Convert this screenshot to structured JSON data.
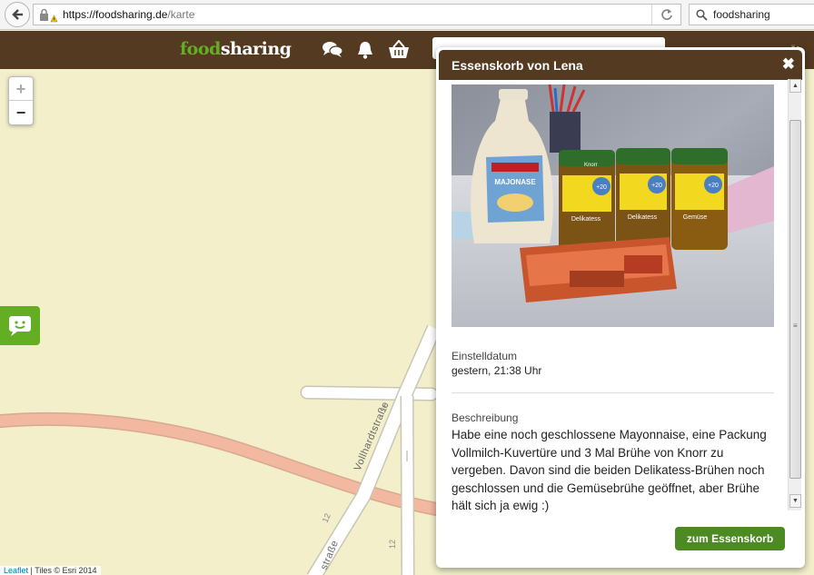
{
  "browser": {
    "url_domain": "https://foodsharing.de",
    "url_path": "/karte",
    "search_value": "foodsharing"
  },
  "header": {
    "logo_part1": "food",
    "logo_part2": "sharing",
    "clipped_text": "ör"
  },
  "map": {
    "zoom_in": "+",
    "zoom_out": "−",
    "street_label": "Vollhardtstraße",
    "street_label_2": "straße",
    "house_numbers": [
      "10",
      "12",
      "12"
    ],
    "attribution_leaflet": "Leaflet",
    "attribution_rest": " | Tiles © Esri 2014"
  },
  "popup": {
    "title": "Essenskorb von Lena",
    "close": "✖",
    "date_label": "Einstelldatum",
    "date_value": "gestern, 21:38 Uhr",
    "desc_label": "Beschreibung",
    "desc_text": "Habe eine noch geschlossene Mayonnaise, eine Packung Vollmilch-Kuvertüre und 3 Mal Brühe von Knorr zu vergeben. Davon sind die beiden Delikatess-Brühen noch geschlossen und die Gemüsebrühe geöffnet, aber Brühe hält sich ja ewig :)",
    "button_label": "zum Essenskorb",
    "photo_text": {
      "mayo": "MAJONASE",
      "jar1": "Delikatess",
      "jar2": "Delikatess",
      "jar3": "Gemüse",
      "knorr": "Knorr",
      "plus": "+20"
    }
  },
  "colors": {
    "brand_brown": "#533a20",
    "brand_green": "#64ae24",
    "button_green": "#4d8a24",
    "map_bg": "#f2efca",
    "main_road": "#f2b9a0"
  },
  "icons": [
    "back-arrow-icon",
    "lock-warning-icon",
    "reload-icon",
    "search-icon",
    "chat-icon",
    "bell-icon",
    "basket-icon",
    "feedback-icon",
    "close-icon"
  ]
}
